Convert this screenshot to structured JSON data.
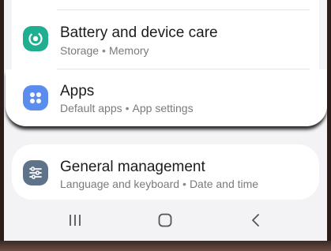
{
  "settings": {
    "battery": {
      "title": "Battery and device care",
      "sub1": "Storage",
      "sub2": "Memory",
      "icon": "battery-care-icon",
      "color": "#1fae8f"
    },
    "apps": {
      "title": "Apps",
      "sub1": "Default apps",
      "sub2": "App settings",
      "icon": "apps-grid-icon",
      "color": "#5b8dee"
    },
    "general": {
      "title": "General management",
      "sub1": "Language and keyboard",
      "sub2": "Date and time",
      "icon": "sliders-icon",
      "color": "#5e7289"
    },
    "separator": "•"
  },
  "navbar": {
    "recents": "recents-icon",
    "home": "home-icon",
    "back": "back-icon"
  }
}
